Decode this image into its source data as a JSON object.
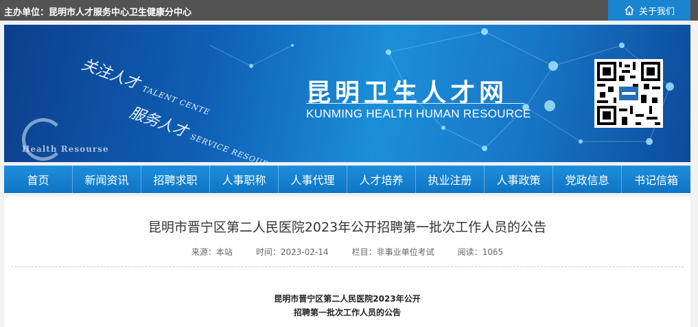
{
  "topbar": {
    "host": "主办单位：昆明市人才服务中心卫生健康分中心",
    "about_label": "关于我们",
    "about_icon": "home-icon"
  },
  "banner": {
    "slogan1_cn": "关注人才",
    "slogan1_en": "TALENT CENTE",
    "slogan2_cn": "服务人才",
    "slogan2_en": "SERVICE RESOURCES",
    "logo_text": "Health Resourse",
    "site_name_cn": "昆明卫生人才网",
    "site_name_en": "KUNMING HEALTH HUMAN RESOURCE"
  },
  "nav": {
    "items": [
      {
        "label": "首页"
      },
      {
        "label": "新闻资讯"
      },
      {
        "label": "招聘求职"
      },
      {
        "label": "人事职称"
      },
      {
        "label": "人事代理"
      },
      {
        "label": "人才培养"
      },
      {
        "label": "执业注册"
      },
      {
        "label": "人事政策"
      },
      {
        "label": "党政信息"
      },
      {
        "label": "书记信箱"
      }
    ]
  },
  "article": {
    "title": "昆明市晋宁区第二人民医院2023年公开招聘第一批次工作人员的公告",
    "source": "来源：本站",
    "time": "时间：2023-02-14",
    "column": "栏目：非事业单位考试",
    "reads": "阅读：1065",
    "body_title_line1": "昆明市晋宁区第二人民医院2023年公开",
    "body_title_line2": "招聘第一批次工作人员的公告"
  },
  "colors": {
    "topbar": "#535353",
    "accent": "#1a84d0",
    "nav": "#1482d0"
  }
}
